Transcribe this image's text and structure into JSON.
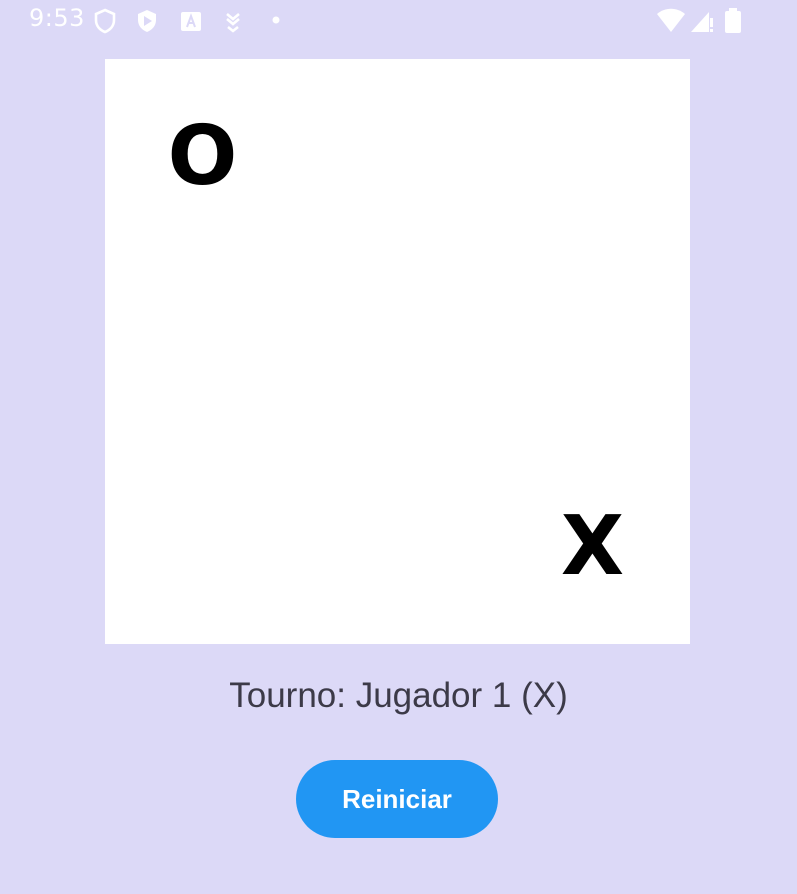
{
  "status_bar": {
    "time": "9:53",
    "left_icons": [
      "shield-icon",
      "play-store-icon",
      "translate-icon",
      "download-icon",
      "dot-icon"
    ],
    "right_icons": [
      "wifi-icon",
      "signal-icon",
      "battery-icon"
    ]
  },
  "board": {
    "cells": [
      "O",
      "",
      "",
      "",
      "",
      "",
      "",
      "",
      "X"
    ]
  },
  "turn_text": "Tourno: Jugador 1 (X)",
  "restart_label": "Reiniciar",
  "colors": {
    "background": "#DCD9F7",
    "board": "#FFFFFF",
    "accent": "#2196F3"
  }
}
